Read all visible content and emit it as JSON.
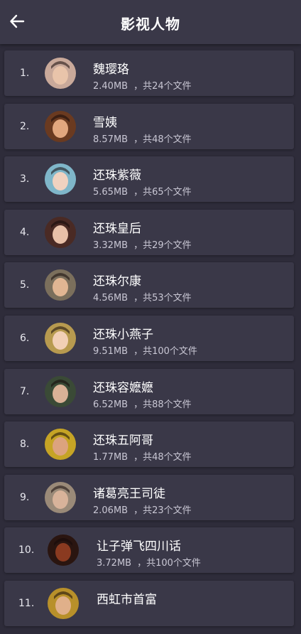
{
  "header": {
    "title": "影视人物",
    "back_icon": "arrow-left-icon"
  },
  "items": [
    {
      "index": "1.",
      "name": "魏璎珞",
      "size": "2.40MB",
      "count": "，共24个文件",
      "avatar_bg": "#c9a99a",
      "face": "#e9c4aa"
    },
    {
      "index": "2.",
      "name": "雪姨",
      "size": "8.57MB",
      "count": "，共48个文件",
      "avatar_bg": "#6a3a20",
      "face": "#e2a77e"
    },
    {
      "index": "3.",
      "name": "还珠紫薇",
      "size": "5.65MB",
      "count": "，共65个文件",
      "avatar_bg": "#7fb6c9",
      "face": "#f0d2c0"
    },
    {
      "index": "4.",
      "name": "还珠皇后",
      "size": "3.32MB",
      "count": "，共29个文件",
      "avatar_bg": "#4a2a24",
      "face": "#e8c0a8"
    },
    {
      "index": "5.",
      "name": "还珠尔康",
      "size": "4.56MB",
      "count": "，共53个文件",
      "avatar_bg": "#7b6f5c",
      "face": "#e1b693"
    },
    {
      "index": "6.",
      "name": "还珠小燕子",
      "size": "9.51MB",
      "count": "，共100个文件",
      "avatar_bg": "#b79a4f",
      "face": "#f2d0b6"
    },
    {
      "index": "7.",
      "name": "还珠容嬷嬷",
      "size": "6.52MB",
      "count": "，共88个文件",
      "avatar_bg": "#3a4a36",
      "face": "#d9b196"
    },
    {
      "index": "8.",
      "name": "还珠五阿哥",
      "size": "1.77MB",
      "count": "，共48个文件",
      "avatar_bg": "#c6a425",
      "face": "#dca37e"
    },
    {
      "index": "9.",
      "name": "诸葛亮王司徒",
      "size": "2.06MB",
      "count": "，共23个文件",
      "avatar_bg": "#9a8a78",
      "face": "#d8b39a"
    },
    {
      "index": "10.",
      "name": "让子弹飞四川话",
      "size": "3.72MB",
      "count": "，共100个文件",
      "avatar_bg": "#2a1510",
      "face": "#8a3a20"
    },
    {
      "index": "11.",
      "name": "西虹市首富",
      "size": "",
      "count": "",
      "avatar_bg": "#b8902a",
      "face": "#e0b08a"
    }
  ]
}
